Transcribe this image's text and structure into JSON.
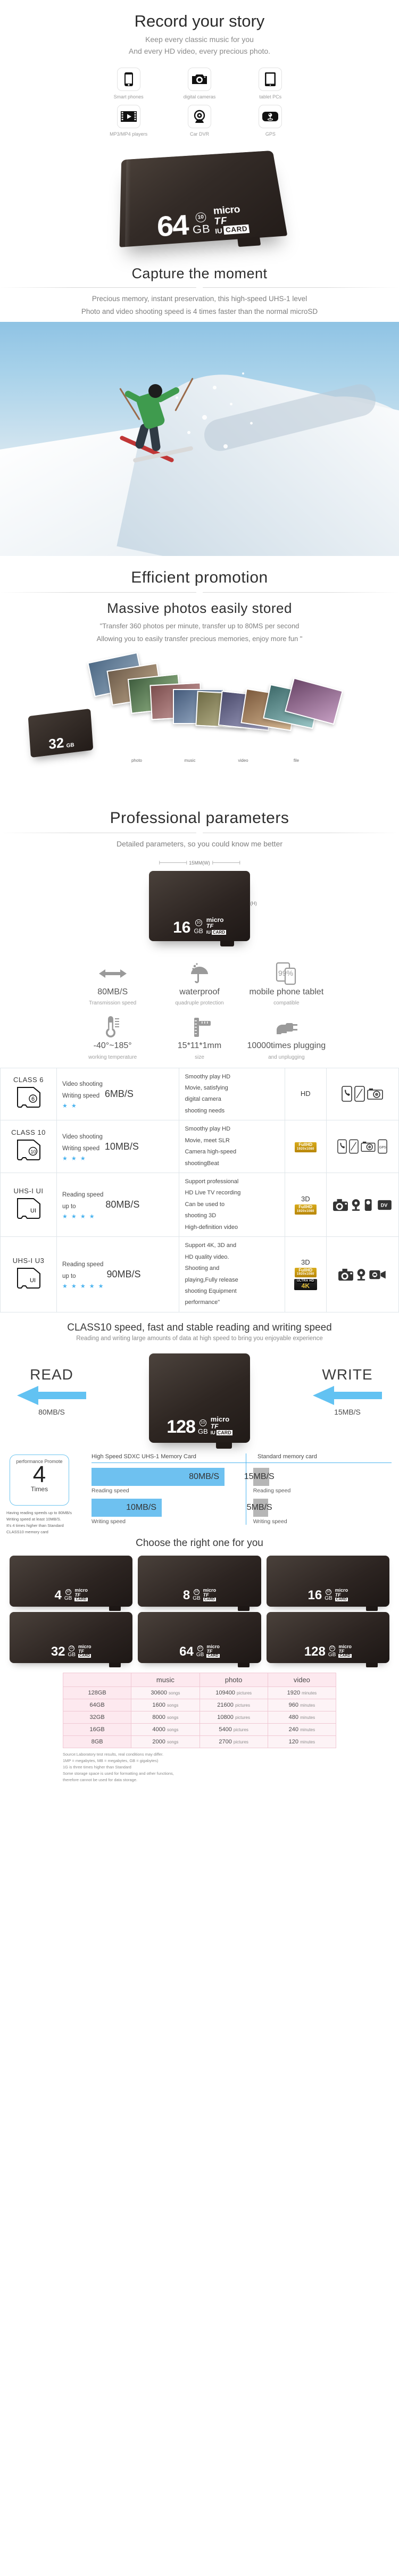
{
  "hero": {
    "title": "Record your story",
    "line1": "Keep every classic music for you",
    "line2": "And every HD video, every precious photo.",
    "devices": [
      {
        "label": "Smart phones",
        "icon": "smartphone-icon"
      },
      {
        "label": "digital cameras",
        "icon": "camera-icon"
      },
      {
        "label": "tablet PCs",
        "icon": "tablet-icon"
      },
      {
        "label": "MP3/MP4 players",
        "icon": "media-player-icon"
      },
      {
        "label": "Car DVR",
        "icon": "dashcam-icon"
      },
      {
        "label": "GPS",
        "icon": "gps-icon"
      }
    ]
  },
  "hero_card": {
    "capacity": "64",
    "gb": "GB",
    "class": "10",
    "micro": "micro",
    "tf": "TF",
    "u1": "IU",
    "card": "CARD"
  },
  "capture": {
    "title": "Capture the moment",
    "line1": "Precious memory, instant preservation, this high-speed UHS-1 level",
    "line2": "Photo and video shooting speed is 4 times faster than the normal microSD"
  },
  "efficient": {
    "title": "Efficient promotion",
    "subtitle": "Massive photos easily stored",
    "line1": "\"Transfer 360 photos per minute, transfer up to 80MS per second",
    "line2": "Allowing you to easily transfer precious memories, enjoy more fun \"",
    "card_capacity": "32",
    "card_gb": "GB",
    "thumb_labels": [
      "photo",
      "music",
      "video",
      "file"
    ]
  },
  "professional": {
    "title": "Professional parameters",
    "subtitle": "Detailed parameters, so you could know me better",
    "dim_width": "15MM(W)",
    "dim_height": "11MM(H)",
    "card_capacity": "16",
    "card_gb": "GB",
    "features": [
      {
        "value": "80MB/S",
        "caption": "Transmission speed",
        "icon": "double-arrow-icon"
      },
      {
        "value": "waterproof",
        "caption": "quadruple protection",
        "icon": "umbrella-icon"
      },
      {
        "value": "mobile phone tablet",
        "caption": "compatible",
        "icon": "phone-tablet-icon"
      },
      {
        "value": "-40°~185°",
        "caption": "working temperature",
        "icon": "thermometer-icon"
      },
      {
        "value": "15*11*1mm",
        "caption": "size",
        "icon": "ruler-icon"
      },
      {
        "value": "10000times plugging",
        "caption": "and unplugging",
        "icon": "plug-icon"
      }
    ]
  },
  "class_table": {
    "rows": [
      {
        "class": "CLASS  6",
        "chip": "6",
        "labels": [
          "Video shooting",
          "Writing speed"
        ],
        "stars": 2,
        "speed": "6MB/S",
        "desc": [
          "Smoothy play HD",
          "Movie, satisfying",
          "digital camera",
          "shooting needs"
        ],
        "quality": "HD",
        "badges": [],
        "devices": [
          "phone-icon",
          "smartphone-icon",
          "camera-icon"
        ]
      },
      {
        "class": "CLASS 10",
        "chip": "10",
        "labels": [
          "Video shooting",
          "Writing speed"
        ],
        "stars": 3,
        "speed": "10MB/S",
        "desc": [
          "Smoothy play HD",
          "Movie, meet SLR",
          "Camera high-speed",
          "shootingBeat"
        ],
        "quality": "",
        "badges": [
          "fullhd"
        ],
        "devices": [
          "phone-icon",
          "smartphone-icon",
          "camera-icon",
          "gps-icon"
        ]
      },
      {
        "class": "UHS-I  UI",
        "chip": "UI",
        "labels": [
          "Reading speed",
          "up to"
        ],
        "stars": 4,
        "speed": "80MB/S",
        "desc": [
          "Support professional",
          "HD Live TV recording",
          "Can be used to",
          "shooting 3D",
          "High-definition video"
        ],
        "quality": "3D",
        "badges": [
          "fullhd"
        ],
        "devices": [
          "dslr-icon",
          "webcam-icon",
          "camcorder-icon",
          "dv-icon"
        ]
      },
      {
        "class": "UHS-I  U3",
        "chip": "UI",
        "labels": [
          "Reading speed",
          "up to"
        ],
        "stars": 5,
        "speed": "90MB/S",
        "desc": [
          "Support 4K, 3D and",
          "HD quality video.",
          "Shooting and",
          "playing,Fully release",
          "shooting Equipment",
          "performance\""
        ],
        "quality": "3D",
        "badges": [
          "fullhd",
          "4k"
        ],
        "devices": [
          "dslr-icon",
          "webcam-icon",
          "video-camera-icon"
        ]
      }
    ],
    "badge_fullhd": "FullHD",
    "badge_fullhd_sub": "1920x1080",
    "badge_4k": "4K",
    "badge_4k_sub": "ULTRA HD"
  },
  "readwrite": {
    "title": "CLASS10 speed, fast and stable reading and writing speed",
    "subtitle": "Reading and writing large amounts of data at high speed to bring you enjoyable experience",
    "read_label": "READ",
    "read_speed": "80MB/S",
    "write_label": "WRITE",
    "write_speed": "15MB/S",
    "card_capacity": "128",
    "card_gb": "GB"
  },
  "performance": {
    "box_title": "performance Promote",
    "box_number": "4",
    "box_times": "Times",
    "note": [
      "Having reading speeds up to 80MB/s",
      "Writing speed at least 10MB/S.",
      "It's 4 times higher than Standard",
      "CLASS10 memory card"
    ],
    "col_left_head": "High Speed SDXC UHS-1 Memory Card",
    "col_right_head": "Standard memory card",
    "left_read_value": "80MB/S",
    "left_read_caption": "Reading speed",
    "left_write_value": "10MB/S",
    "left_write_caption": "Writing speed",
    "right_read_value": "15MB/S",
    "right_read_caption": "Reading speed",
    "right_write_value": "5MB/S",
    "right_write_caption": "Writing speed"
  },
  "choose": {
    "title": "Choose the right one for you",
    "cards": [
      {
        "capacity": "4",
        "gb": "GB"
      },
      {
        "capacity": "8",
        "gb": "GB"
      },
      {
        "capacity": "16",
        "gb": "GB"
      },
      {
        "capacity": "32",
        "gb": "GB"
      },
      {
        "capacity": "64",
        "gb": "GB"
      },
      {
        "capacity": "128",
        "gb": "GB"
      }
    ]
  },
  "chart_data": {
    "type": "table",
    "title": "",
    "columns": [
      "",
      "music",
      "photo",
      "video"
    ],
    "rows": [
      {
        "capacity": "128GB",
        "music": "30600",
        "music_unit": "songs",
        "photo": "109400",
        "photo_unit": "pictures",
        "video": "1920",
        "video_unit": "minutes"
      },
      {
        "capacity": "64GB",
        "music": "1600",
        "music_unit": "songs",
        "photo": "21600",
        "photo_unit": "pictures",
        "video": "960",
        "video_unit": "minutes"
      },
      {
        "capacity": "32GB",
        "music": "8000",
        "music_unit": "songs",
        "photo": "10800",
        "photo_unit": "pictures",
        "video": "480",
        "video_unit": "minutes"
      },
      {
        "capacity": "16GB",
        "music": "4000",
        "music_unit": "songs",
        "photo": "5400",
        "photo_unit": "pictures",
        "video": "240",
        "video_unit": "minutes"
      },
      {
        "capacity": "8GB",
        "music": "2000",
        "music_unit": "songs",
        "photo": "2700",
        "photo_unit": "pictures",
        "video": "120",
        "video_unit": "minutes"
      }
    ],
    "footnote": [
      "Source:Laboratory test results, real conditions may differ.",
      "1MP = megabytes, MB = megabytes, GB = gigabytes)",
      "1G is three times higher than Standard",
      "Some storage space is used for formatting and other functions,",
      "therefore cannot be used for data storage."
    ]
  }
}
